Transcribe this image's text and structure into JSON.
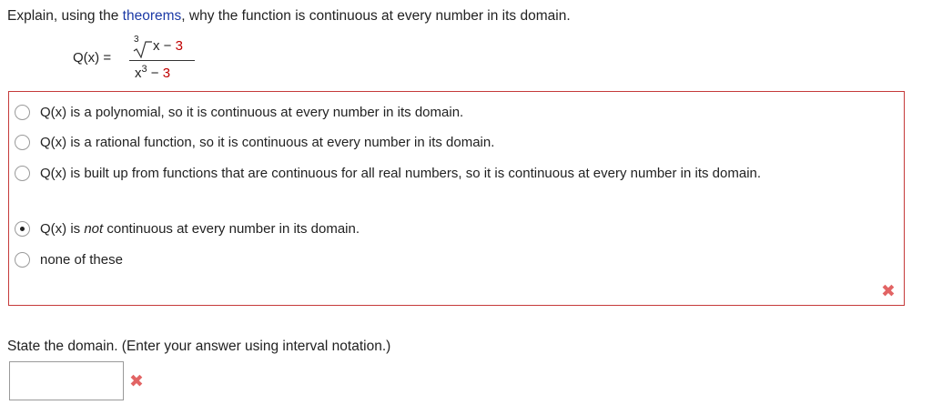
{
  "prompt": {
    "before": "Explain, using the ",
    "link": "theorems",
    "after": ", why the function is continuous at every number in its domain."
  },
  "formula": {
    "lhs": "Q(x) =",
    "root_index": "3",
    "radicand_var": "x − ",
    "radicand_const": "3",
    "den_base": "x",
    "den_exp": "3",
    "den_minus": " − ",
    "den_const": "3"
  },
  "choices": [
    {
      "label": "Q(x) is a polynomial, so it is continuous at every number in its domain.",
      "selected": false
    },
    {
      "label": "Q(x) is a rational function, so it is continuous at every number in its domain.",
      "selected": false
    },
    {
      "label": "Q(x) is built up from functions that are continuous for all real numbers, so it is continuous at every number in its domain.",
      "selected": false
    },
    {
      "label_before": "Q(x) is ",
      "label_em": "not",
      "label_after": " continuous at every number in its domain.",
      "selected": true
    },
    {
      "label": "none of these",
      "selected": false
    }
  ],
  "incorrect_mark": "✖",
  "domain": {
    "prompt": "State the domain. (Enter your answer using interval notation.)",
    "value": ""
  },
  "colors": {
    "link": "#1c3aa6",
    "highlight_red": "#c00000",
    "box_border": "#c53a3a",
    "x_mark": "#e26464"
  }
}
